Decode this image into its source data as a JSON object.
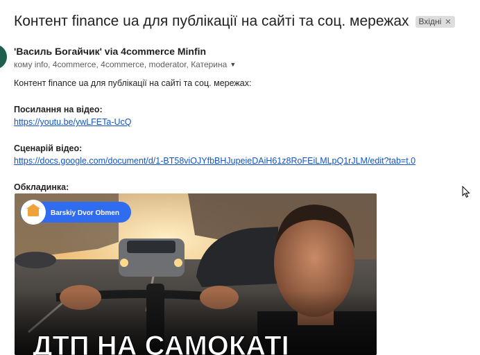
{
  "email": {
    "subject": "Контент finance ua для публікації на сайті та соц. мережах",
    "label_chip": "Вхідні",
    "sender": "'Василь Богайчик' via 4commerce Minfin",
    "recipients": "кому info, 4commerce, 4commerce, moderator, Катерина",
    "intro": "Контент finance ua для публікації на сайті та соц. мережах:",
    "video_heading": "Посилання на відео:",
    "video_link": "https://youtu.be/ywLFETa-UcQ",
    "script_heading": "Сценарій відео:",
    "script_link": "https://docs.google.com/document/d/1-BT58viOJYfbBHJupeieDAiH61z8RoFEiLMLpQ1rJLM/edit?tab=t.0",
    "cover_heading": "Обкладинка:"
  },
  "thumbnail": {
    "channel_badge": "Barskiy Dvor Obmen",
    "title_text": "ДТП НА САМОКАТІ"
  },
  "colors": {
    "link": "#1155cc",
    "chip_bg": "#dddddd",
    "badge_blue": "#2f6cf0",
    "avatar": "#1e5f4e"
  }
}
